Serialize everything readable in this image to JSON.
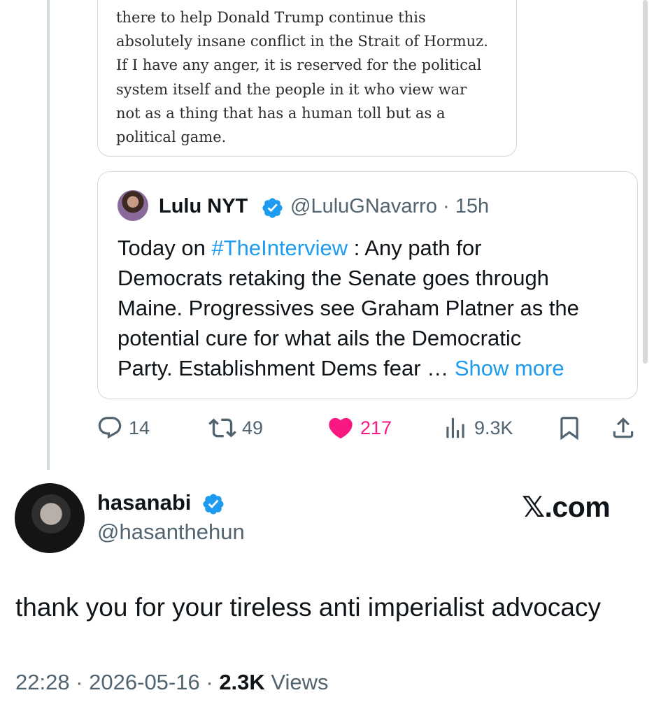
{
  "quoted_article": {
    "text": "there to help Donald Trump continue this\nabsolutely insane conflict in the Strait of Hormuz.\nIf I have any anger, it is reserved for the political\nsystem itself and the people in it who view war\nnot as a thing that has a human toll but as a\npolitical game."
  },
  "quoted_post": {
    "name": "Lulu NYT",
    "handle": "@LuluGNavarro",
    "separator": "·",
    "age": "15h",
    "text_before": "Today on ",
    "hashtag": "#TheInterview",
    "text_after": " : Any path for\nDemocrats retaking the Senate goes through\nMaine. Progressives see Graham Platner as the\npotential cure for what ails the Democratic\nParty. Establishment Dems fear … ",
    "show_more": "Show more"
  },
  "actions": {
    "replies": "14",
    "reposts": "49",
    "likes": "217",
    "views": "9.3K"
  },
  "post": {
    "name": "hasanabi",
    "handle": "@hasanthehun",
    "watermark": "𝕏.com",
    "text": "thank you for your tireless anti imperialist advocacy",
    "time": "22:28",
    "separator": "·",
    "date": "2026-05-16",
    "views_count": "2.3K",
    "views_label": "Views"
  },
  "icons": {
    "reply": "reply-icon",
    "repost": "repost-icon",
    "like": "heart-icon",
    "views": "views-icon",
    "bookmark": "bookmark-icon",
    "share": "share-icon",
    "verified": "verified-badge-icon"
  },
  "colors": {
    "accent": "#1d9bf0",
    "like": "#f91880",
    "secondary_text": "#536471"
  }
}
